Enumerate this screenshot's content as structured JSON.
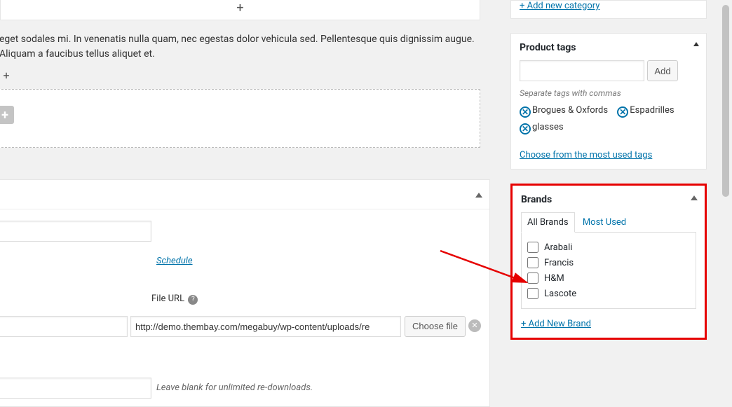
{
  "editor": {
    "lorem_text": "eget sodales mi. In venenatis nulla quam, nec egestas dolor vehicula sed. Pellentesque quis dignissim augue. Aliquam a faucibus tellus aliquet et."
  },
  "product_panel": {
    "schedule_label": "Schedule",
    "file_url_label": "File URL",
    "url_value": "http://demo.thembay.com/megabuy/wp-content/uploads/re",
    "choose_file_label": "Choose file",
    "blank_note": "Leave blank for unlimited re-downloads."
  },
  "categories": {
    "add_new_label": "+ Add new category"
  },
  "tags": {
    "title": "Product tags",
    "add_label": "Add",
    "note": "Separate tags with commas",
    "items": [
      "Brogues & Oxfords",
      "Espadrilles",
      "glasses"
    ],
    "choose_link": "Choose from the most used tags"
  },
  "brands": {
    "title": "Brands",
    "tab_all": "All Brands",
    "tab_most": "Most Used",
    "items": [
      "Arabali",
      "Francis",
      "H&M",
      "Lascote"
    ],
    "add_new_label": "+ Add New Brand"
  }
}
